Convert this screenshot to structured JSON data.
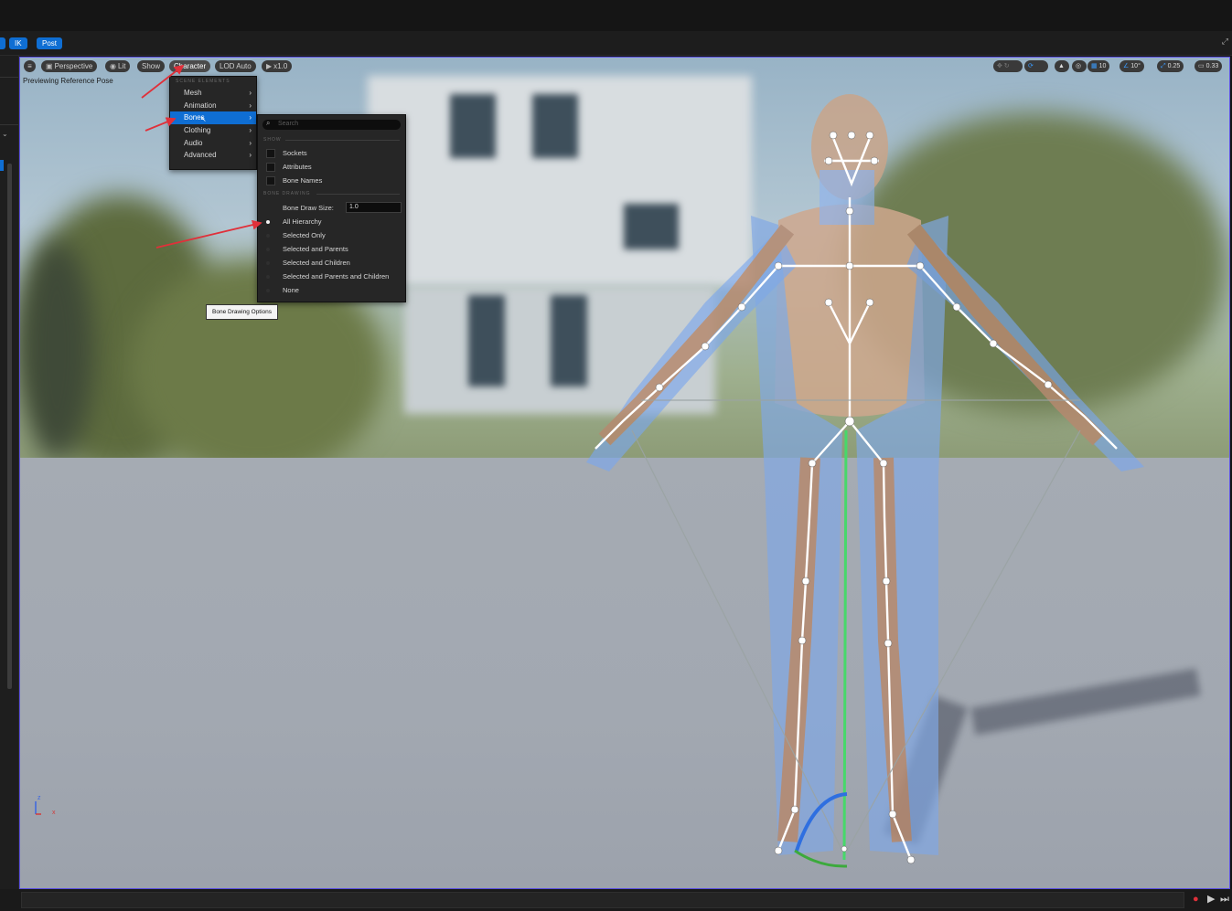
{
  "tabs": {
    "ik_label": "IK",
    "post_label": "Post"
  },
  "viewport_toolbar": {
    "perspective_label": "Perspective",
    "lit_label": "Lit",
    "show_label": "Show",
    "character_label": "Character",
    "lod_label": "LOD Auto",
    "play_speed_label": "x1.0",
    "grid_value": "10",
    "rotation_snap_value": "10°",
    "scale_snap_value": "0.25",
    "camera_speed_value": "0.33"
  },
  "preview_text": "Previewing Reference Pose",
  "character_menu": {
    "section_header": "SCENE ELEMENTS",
    "items": [
      {
        "label": "Mesh"
      },
      {
        "label": "Animation"
      },
      {
        "label": "Bones"
      },
      {
        "label": "Clothing"
      },
      {
        "label": "Audio"
      },
      {
        "label": "Advanced"
      }
    ],
    "highlighted": "Bones"
  },
  "bones_submenu": {
    "search_placeholder": "Search",
    "show_header": "SHOW",
    "show_items": [
      {
        "label": "Sockets",
        "checked": false
      },
      {
        "label": "Attributes",
        "checked": false
      },
      {
        "label": "Bone Names",
        "checked": false
      }
    ],
    "bone_drawing_header": "BONE DRAWING",
    "bone_draw_size_label": "Bone Draw Size:",
    "bone_draw_size_value": "1.0",
    "drawing_options": [
      {
        "label": "All Hierarchy",
        "selected": true
      },
      {
        "label": "Selected Only",
        "selected": false
      },
      {
        "label": "Selected and Parents",
        "selected": false
      },
      {
        "label": "Selected and Children",
        "selected": false
      },
      {
        "label": "Selected and Parents and Children",
        "selected": false
      },
      {
        "label": "None",
        "selected": false
      }
    ]
  },
  "tooltip": "Bone Drawing Options",
  "axis": {
    "z": "z",
    "x": "x"
  },
  "colors": {
    "accent": "#0f6ed3",
    "viewport_border": "#5d52e0",
    "annotation_arrow": "#e0303a",
    "record": "#e0303a"
  },
  "icons": {
    "menu": "hamburger-icon",
    "perspective": "camera-icon",
    "lit": "sun-icon",
    "play": "play-icon",
    "search": "search-icon",
    "record": "record-icon"
  }
}
